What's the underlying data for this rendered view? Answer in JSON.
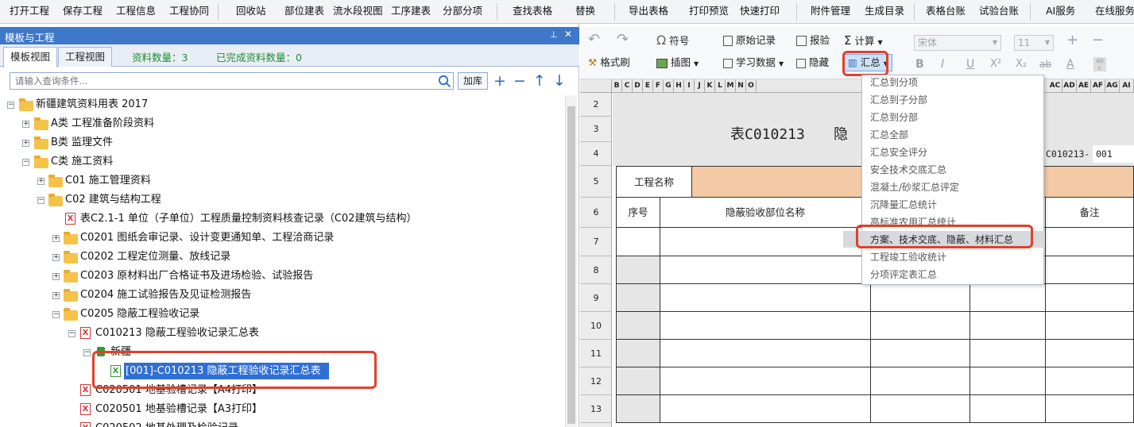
{
  "menu": [
    "打开工程",
    "保存工程",
    "工程信息",
    "工程协同",
    "回收站",
    "部位建表",
    "流水段视图",
    "工序建表",
    "分部分项",
    "查找表格",
    "替换",
    "导出表格",
    "打印预览",
    "快速打印",
    "附件管理",
    "生成目录",
    "表格台账",
    "试验台账",
    "AI服务",
    "在线服务"
  ],
  "left_panel": {
    "title": "模板与工程",
    "pin_icon": "📌",
    "close_icon": "✕",
    "tabs": [
      "模板视图",
      "工程视图"
    ],
    "stat_count": "资料数量：3",
    "stat_done": "已完成资料数量：0",
    "search_placeholder": "请输入查询条件...",
    "lib_button": "加库",
    "tools": {
      "add": "+",
      "remove": "−",
      "up": "↑",
      "down": "↓"
    }
  },
  "tree": {
    "root": "新疆建筑资料用表 2017",
    "a": "A类 工程准备阶段资料",
    "b": "B类 监理文件",
    "c": "C类 施工资料",
    "c01": "C01 施工管理资料",
    "c02": "C02 建筑与结构工程",
    "c21": "表C2.1-1 单位（子单位）工程质量控制资料核查记录（C02建筑与结构）",
    "c0201": "C0201 图纸会审记录、设计变更通知单、工程洽商记录",
    "c0202": "C0202 工程定位测量、放线记录",
    "c0203": "C0203 原材料出厂合格证书及进场检验、试验报告",
    "c0204": "C0204 施工试验报告及见证检测报告",
    "c0205": "C0205 隐蔽工程验收记录",
    "c010213": "C010213 隐蔽工程验收记录汇总表",
    "xinjiang": "新疆",
    "selected": "[001]-C010213 隐蔽工程验收记录汇总表",
    "c020501a": "C020501 地基验槽记录【A4打印】",
    "c020501b": "C020501 地基验槽记录【A3打印】",
    "c020502": "C020502 地基处理及检验记录"
  },
  "ribbon": {
    "undo": "↶",
    "redo": "↷",
    "symbol": "符号",
    "raw_record": "原始记录",
    "report": "报验",
    "calc": "计算",
    "format_brush": "格式刷",
    "insert_image": "插图",
    "study_data": "学习数据",
    "hide": "隐藏",
    "summary": "汇总",
    "font": "宋体",
    "font_size": "11",
    "bold": "B",
    "italic": "I",
    "underline": "U",
    "superscript": "X²",
    "subscript": "X₂",
    "strike": "ab",
    "font_color": "A",
    "plus": "+",
    "minus": "−"
  },
  "columns": [
    "B",
    "C",
    "D",
    "E",
    "F",
    "G",
    "H",
    "I",
    "J",
    "K",
    "L",
    "M",
    "N",
    "O",
    "AC",
    "AD",
    "AE",
    "AF",
    "AG",
    "AI"
  ],
  "rows": [
    "2",
    "3",
    "4",
    "5",
    "6",
    "7",
    "8",
    "9",
    "10",
    "11",
    "12",
    "13"
  ],
  "sheet": {
    "title_left": "表C010213",
    "title_right": "隐",
    "code": "C010213-",
    "code_num": "001",
    "project_name": "工程名称",
    "col_seq": "序号",
    "col_part": "隐蔽验收部位名称",
    "col_note": "备注"
  },
  "dropdown": [
    "汇总到分项",
    "汇总到子分部",
    "汇总到分部",
    "汇总全部",
    "汇总安全评分",
    "安全技术交底汇总",
    "混凝土/砂浆汇总评定",
    "沉降量汇总统计",
    "高标准农用汇总统计",
    "方案、技术交底、隐蔽、材料汇总",
    "工程竣工验收统计",
    "分项评定表汇总"
  ],
  "colors": {
    "title_blue": "#3f78c9",
    "highlight_red": "#e2402b",
    "selection_blue": "#2f6fd6",
    "orange_cell": "#f3c9a6"
  }
}
